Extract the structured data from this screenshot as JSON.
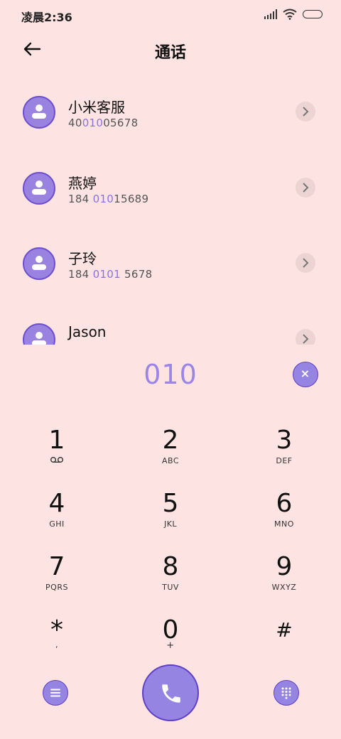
{
  "status_bar": {
    "time": "凌晨2:36"
  },
  "header": {
    "title": "通话"
  },
  "contacts": [
    {
      "name": "小米客服",
      "number_parts": [
        "40",
        "010",
        "05678"
      ]
    },
    {
      "name": "燕婷",
      "number_parts": [
        "184 ",
        "010",
        "15689"
      ]
    },
    {
      "name": "子玲",
      "number_parts": [
        "184 ",
        "0101",
        " 5678"
      ]
    },
    {
      "name": "Jason",
      "number_parts": [
        "",
        "",
        ""
      ]
    }
  ],
  "dial": {
    "input": "010",
    "clear_symbol": "×"
  },
  "keypad": [
    {
      "digit": "1",
      "letters": ""
    },
    {
      "digit": "2",
      "letters": "ABC"
    },
    {
      "digit": "3",
      "letters": "DEF"
    },
    {
      "digit": "4",
      "letters": "GHI"
    },
    {
      "digit": "5",
      "letters": "JKL"
    },
    {
      "digit": "6",
      "letters": "MNO"
    },
    {
      "digit": "7",
      "letters": "PQRS"
    },
    {
      "digit": "8",
      "letters": "TUV"
    },
    {
      "digit": "9",
      "letters": "WXYZ"
    },
    {
      "digit": "*",
      "letters": ","
    },
    {
      "digit": "0",
      "letters": "+"
    },
    {
      "digit": "#",
      "letters": ""
    }
  ],
  "icons": {
    "back": "arrow-left-icon",
    "clear": "close-icon",
    "menu": "menu-icon",
    "call": "phone-icon",
    "keypad_toggle": "dialpad-icon",
    "voicemail": "voicemail-icon"
  },
  "colors": {
    "accent": "#9684e2",
    "background": "#fde4e2",
    "highlight": "#8b72e2"
  }
}
